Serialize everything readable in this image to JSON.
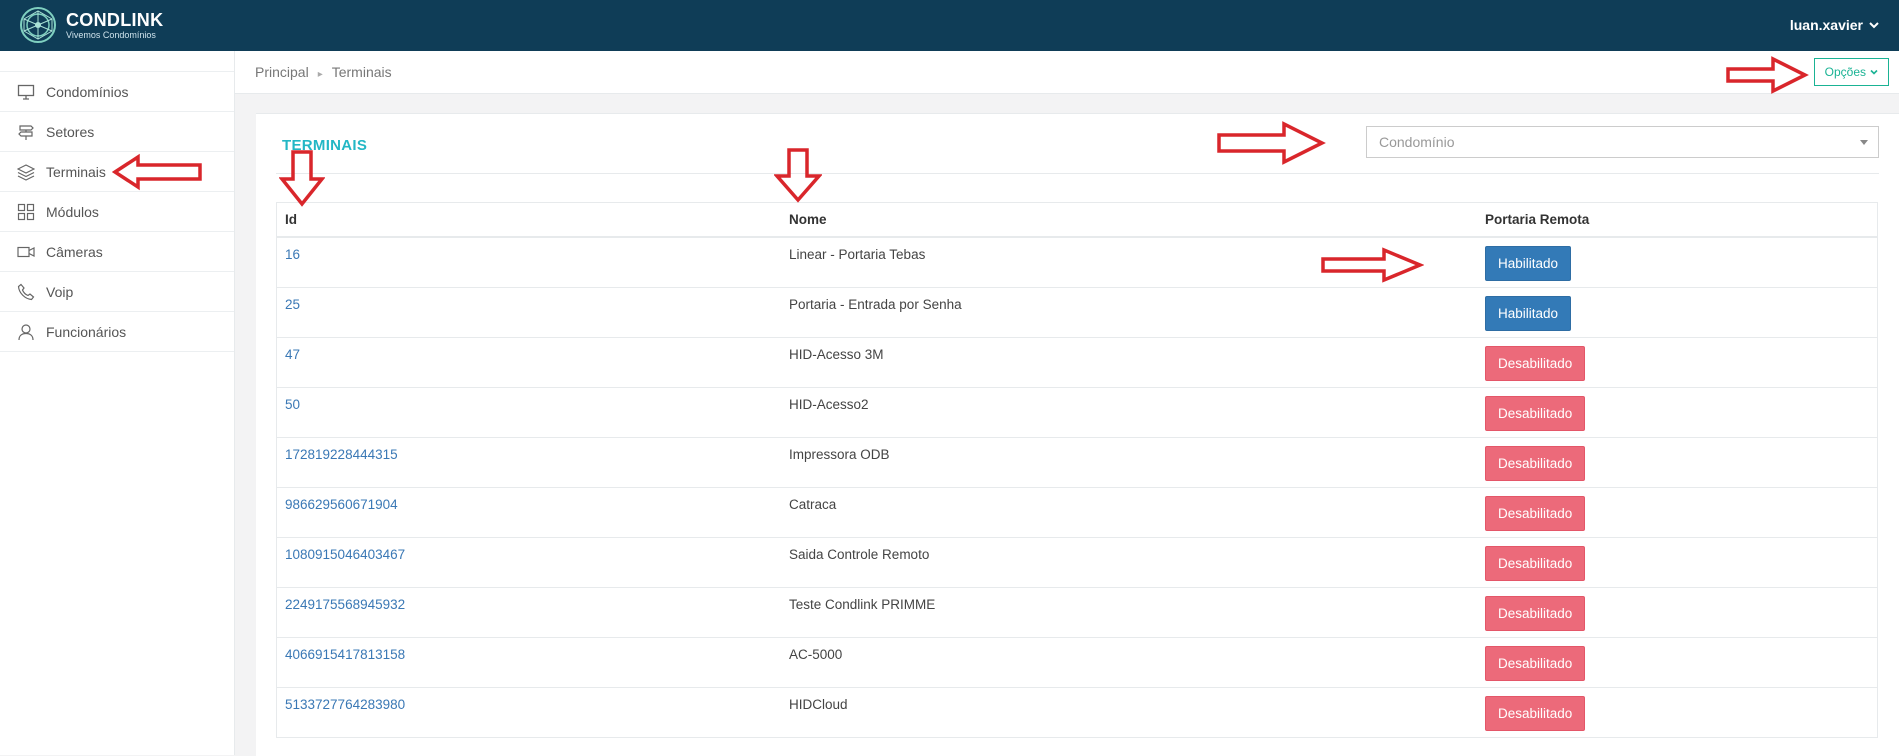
{
  "app": {
    "brand_name": "CONDLINK",
    "brand_tagline": "Vivemos Condomínios",
    "user_name": "luan.xavier"
  },
  "sidebar": {
    "items": [
      {
        "label": "Condomínios",
        "icon": "monitor-icon"
      },
      {
        "label": "Setores",
        "icon": "signpost-icon"
      },
      {
        "label": "Terminais",
        "icon": "layers-icon"
      },
      {
        "label": "Módulos",
        "icon": "grid-icon"
      },
      {
        "label": "Câmeras",
        "icon": "video-camera-icon"
      },
      {
        "label": "Voip",
        "icon": "phone-icon"
      },
      {
        "label": "Funcionários",
        "icon": "user-icon"
      }
    ]
  },
  "breadcrumb": {
    "items": [
      "Principal",
      "Terminais"
    ]
  },
  "header": {
    "options_label": "Opções"
  },
  "panel": {
    "title": "TERMINAIS",
    "condominio_placeholder": "Condomínio"
  },
  "table": {
    "headers": [
      "Id",
      "Nome",
      "Portaria Remota"
    ],
    "rows": [
      {
        "id": "16",
        "nome": "Linear - Portaria Tebas",
        "status": "Habilitado"
      },
      {
        "id": "25",
        "nome": "Portaria - Entrada por Senha",
        "status": "Habilitado"
      },
      {
        "id": "47",
        "nome": "HID-Acesso 3M",
        "status": "Desabilitado"
      },
      {
        "id": "50",
        "nome": "HID-Acesso2",
        "status": "Desabilitado"
      },
      {
        "id": "172819228444315",
        "nome": "Impressora ODB",
        "status": "Desabilitado"
      },
      {
        "id": "986629560671904",
        "nome": "Catraca",
        "status": "Desabilitado"
      },
      {
        "id": "1080915046403467",
        "nome": "Saida Controle Remoto",
        "status": "Desabilitado"
      },
      {
        "id": "2249175568945932",
        "nome": "Teste Condlink PRIMME",
        "status": "Desabilitado"
      },
      {
        "id": "4066915417813158",
        "nome": "AC-5000",
        "status": "Desabilitado"
      },
      {
        "id": "5133727764283980",
        "nome": "HIDCloud",
        "status": "Desabilitado"
      }
    ]
  },
  "colors": {
    "topbar": "#0f3d57",
    "title_accent": "#23b7c5",
    "enabled": "#337ab7",
    "disabled": "#ec6a7a",
    "annotation_arrow": "#d9262b"
  }
}
